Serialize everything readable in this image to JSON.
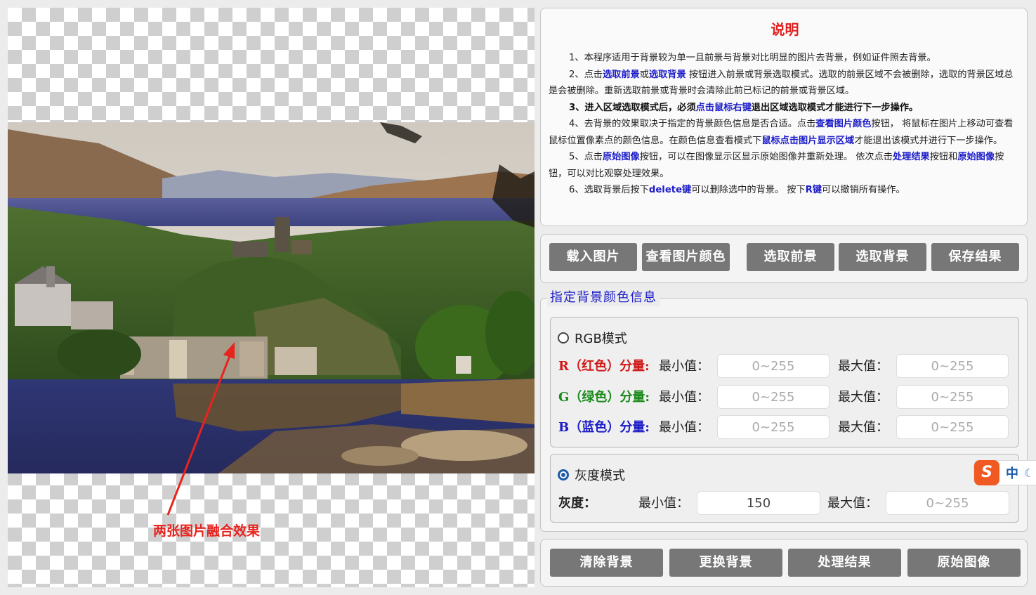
{
  "annotation": "两张图片融合效果",
  "instructions": {
    "title": "说明",
    "p1": "1、本程序适用于背景较为单一且前景与背景对比明显的图片去背景，例如证件照去背景。",
    "p2": {
      "a": "2、点击",
      "b1": "选取前景",
      "c": "或",
      "b2": "选取背景",
      "d": " 按钮进入前景或背景选取模式。选取的前景区域不会被删除，选取的背景区域总是会被删除。重新选取前景或背景时会清除此前已标记的前景或背景区域。"
    },
    "p3": {
      "a": "3、进入区域选取模式后，必须",
      "b": "点击鼠标右键",
      "c": "退出区域选取模式才能进行下一步操作。"
    },
    "p4": {
      "a": "4、去背景的效果取决于指定的背景颜色信息是否合适。点击",
      "b1": "查看图片颜色",
      "c": "按钮， 将鼠标在图片上移动可查看鼠标位置像素点的颜色信息。在颜色信息查看模式下",
      "b2": "鼠标点击图片显示区域",
      "d": "才能退出该模式并进行下一步操作。"
    },
    "p5": {
      "a": "5、点击",
      "b1": "原始图像",
      "c": "按钮，可以在图像显示区显示原始图像并重新处理。 依次点击",
      "b2": "处理结果",
      "d": "按钮和",
      "b3": "原始图像",
      "e": "按钮，可以对比观察处理效果。"
    },
    "p6": {
      "a": "6、选取背景后按下",
      "b1": "delete键",
      "c": "可以删除选中的背景。 按下",
      "b2": "R键",
      "d": "可以撤销所有操作。"
    }
  },
  "toolbar1": {
    "load": "载入图片",
    "view_color": "查看图片颜色",
    "select_fg": "选取前景",
    "select_bg": "选取背景",
    "save": "保存结果"
  },
  "bg_color": {
    "legend": "指定背景颜色信息",
    "rgb_mode": "RGB模式",
    "rgb_checked": false,
    "rows": [
      {
        "label": "R（红色）分量:",
        "color": "#d01818"
      },
      {
        "label": "G（绿色）分量:",
        "color": "#1a8a1a"
      },
      {
        "label": "B（蓝色）分量:",
        "color": "#1b1bc8"
      }
    ],
    "min_label": "最小值：",
    "max_label": "最大值：",
    "range_placeholder": "0~255",
    "gray_mode": "灰度模式",
    "gray_checked": true,
    "gray_label": "灰度：",
    "gray_min_value": "150"
  },
  "toolbar2": {
    "clear_bg": "清除背景",
    "change_bg": "更换背景",
    "result": "处理结果",
    "original": "原始图像"
  },
  "ime": {
    "logo": "S",
    "lang": "中",
    "icon": "moon-icon"
  }
}
